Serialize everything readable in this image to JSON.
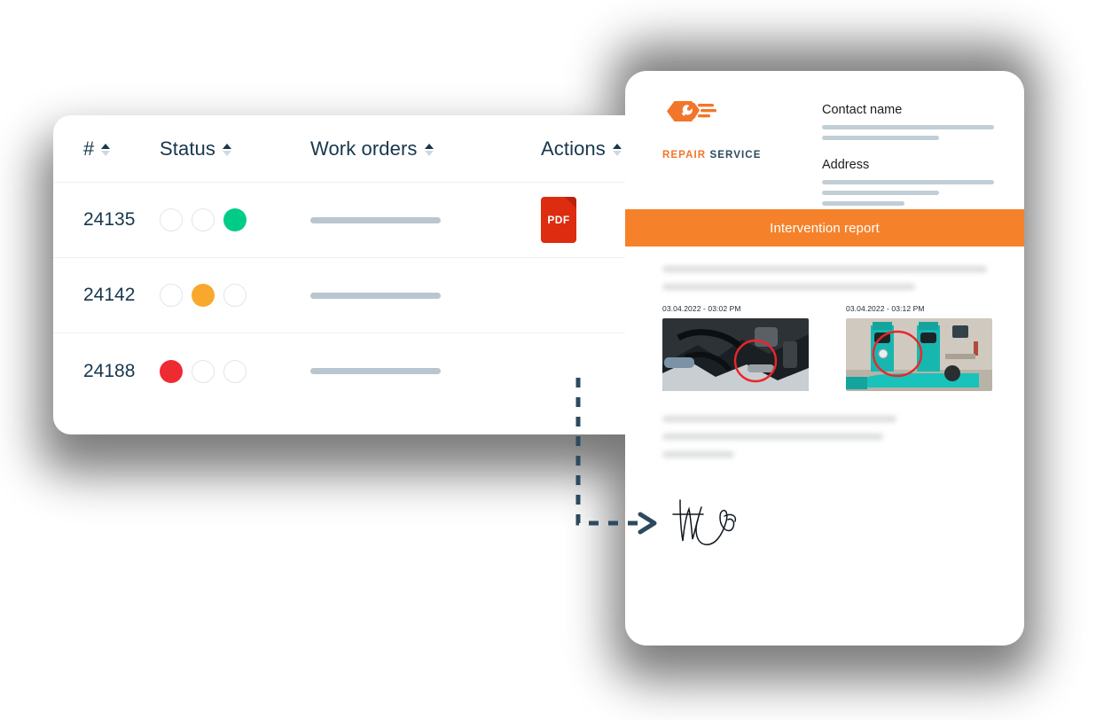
{
  "table": {
    "columns": [
      {
        "label": "#",
        "sortable": true
      },
      {
        "label": "Status",
        "sortable": true
      },
      {
        "label": "Work orders",
        "sortable": true
      },
      {
        "label": "Actions",
        "sortable": true
      }
    ],
    "rows": [
      {
        "id": "24135",
        "status_active_index": 2,
        "status_color": "#00cc88",
        "work_order_placeholder": true,
        "action": "PDF"
      },
      {
        "id": "24142",
        "status_active_index": 1,
        "status_color": "#f9a82e",
        "work_order_placeholder": true,
        "action": ""
      },
      {
        "id": "24188",
        "status_active_index": 0,
        "status_color": "#ef2b32",
        "work_order_placeholder": true,
        "action": ""
      }
    ],
    "status_colors": {
      "red": "#ef2b32",
      "amber": "#f9a82e",
      "green": "#00cc88",
      "empty_border": "#dfe6eb"
    },
    "pdf_badge_color": "#dd2c10"
  },
  "document": {
    "brand": {
      "word_primary": "REPAIR",
      "word_secondary": "SERVICE",
      "primary_color": "#f2762a",
      "secondary_color": "#2b4a5b"
    },
    "fields": [
      {
        "label": "Contact name",
        "lines": [
          100,
          68
        ]
      },
      {
        "label": "Address",
        "lines": [
          100,
          68,
          48
        ]
      }
    ],
    "banner": {
      "title": "Intervention report",
      "background": "#f5822b",
      "text_color": "#ffffff"
    },
    "intro_paragraph_lines": [
      100,
      78
    ],
    "photos": [
      {
        "timestamp": "03.04.2022 - 03:02 PM",
        "caption": "engine-bay-photo"
      },
      {
        "timestamp": "03.04.2022 - 03:12 PM",
        "caption": "pump-room-photo"
      }
    ],
    "closing_paragraph_lines": [
      72,
      68,
      22
    ],
    "signature_label": "handwritten-signature"
  },
  "connector": {
    "style": "dashed-arrow",
    "color": "#2c4a5e"
  }
}
